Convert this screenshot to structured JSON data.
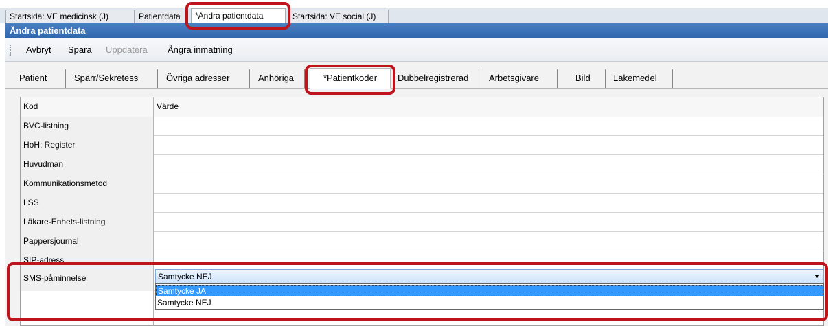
{
  "document_tabs": [
    {
      "label": "Startsida: VE medicinsk (J)"
    },
    {
      "label": "Patientdata"
    },
    {
      "label": "*Ändra patientdata"
    },
    {
      "label": "Startsida: VE social (J)"
    }
  ],
  "window_title": "Ändra patientdata",
  "toolbar": {
    "cancel_label": "Avbryt",
    "save_label": "Spara",
    "update_label": "Uppdatera",
    "undo_label": "Ångra inmatning"
  },
  "patient_tabs": [
    {
      "label": "Patient"
    },
    {
      "label": "Spärr/Sekretess"
    },
    {
      "label": "Övriga adresser"
    },
    {
      "label": "Anhöriga"
    },
    {
      "label": "*Patientkoder"
    },
    {
      "label": "Dubbelregistrerad"
    },
    {
      "label": "Arbetsgivare"
    },
    {
      "label": "Bild"
    },
    {
      "label": "Läkemedel"
    }
  ],
  "grid": {
    "col_kod": "Kod",
    "col_varde": "Värde",
    "rows": [
      {
        "kod": "BVC-listning",
        "varde": ""
      },
      {
        "kod": "HoH: Register",
        "varde": ""
      },
      {
        "kod": "Huvudman",
        "varde": ""
      },
      {
        "kod": "Kommunikationsmetod",
        "varde": ""
      },
      {
        "kod": "LSS",
        "varde": ""
      },
      {
        "kod": "Läkare-Enhets-listning",
        "varde": ""
      },
      {
        "kod": "Pappersjournal",
        "varde": ""
      },
      {
        "kod": "SIP-adress",
        "varde": ""
      },
      {
        "kod": "SMS-påminnelse",
        "varde": "Samtycke NEJ"
      }
    ]
  },
  "dropdown": {
    "selected_value": "Samtycke NEJ",
    "options": [
      "Samtycke JA",
      "Samtycke NEJ"
    ],
    "highlighted_option": "Samtycke JA"
  },
  "colors": {
    "title_bar": "#2f66ad",
    "highlight_frame": "#c0141c",
    "dropdown_selection": "#3399ff"
  }
}
